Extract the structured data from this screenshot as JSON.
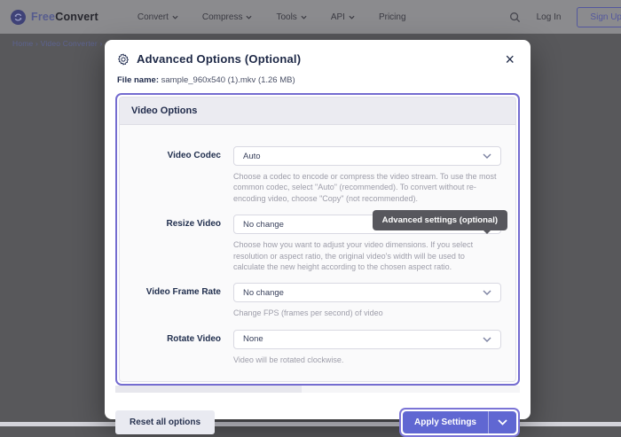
{
  "navbar": {
    "brand_free": "Free",
    "brand_convert": "Convert",
    "menu": [
      {
        "label": "Convert",
        "has_chevron": true
      },
      {
        "label": "Compress",
        "has_chevron": true
      },
      {
        "label": "Tools",
        "has_chevron": true
      },
      {
        "label": "API",
        "has_chevron": true
      },
      {
        "label": "Pricing",
        "has_chevron": false
      }
    ],
    "log_in": "Log In",
    "sign_up": "Sign Up"
  },
  "breadcrumb": "Home  ›  Video Converter  ›",
  "modal": {
    "title": "Advanced Options (Optional)",
    "close": "×",
    "file_label": "File name:",
    "file_value": "sample_960x540 (1).mkv (1.26 MB)",
    "tooltip": "Advanced settings (optional)",
    "panel": {
      "title": "Video Options",
      "rows": [
        {
          "label": "Video Codec",
          "value": "Auto",
          "description": "Choose a codec to encode or compress the video stream. To use the most common codec, select \"Auto\" (recommended). To convert without re-encoding video, choose \"Copy\" (not recommended)."
        },
        {
          "label": "Resize Video",
          "value": "No change",
          "description": "Choose how you want to adjust your video dimensions. If you select resolution or aspect ratio, the original video's width will be used to calculate the new height according to the chosen aspect ratio."
        },
        {
          "label": "Video Frame Rate",
          "value": "No change",
          "description": "Change FPS (frames per second) of video"
        },
        {
          "label": "Rotate Video",
          "value": "None",
          "description": "Video will be rotated clockwise."
        }
      ]
    },
    "reset_button": "Reset all options",
    "apply_button": "Apply Settings"
  },
  "colors": {
    "accent_purple": "#746cd0",
    "apply_button_bg": "#6067d2",
    "tooltip_bg": "#57575d",
    "overlay_gray": "#58585b",
    "title_navy": "#1d2846"
  }
}
